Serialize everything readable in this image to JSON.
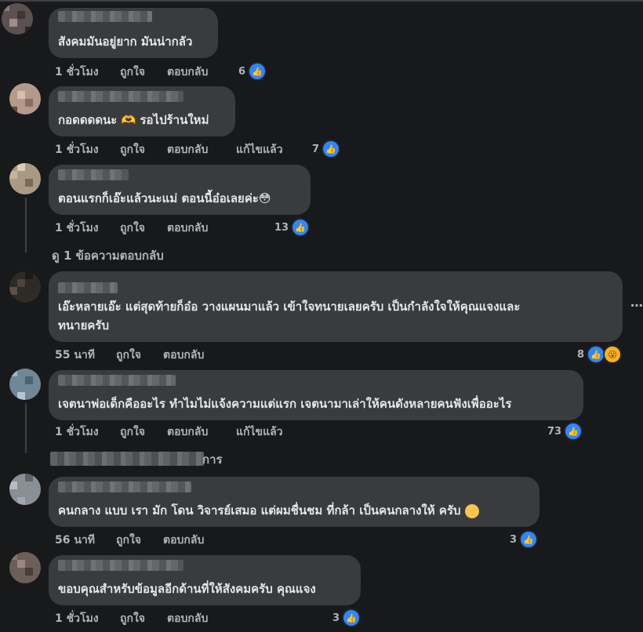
{
  "comments": [
    {
      "text": "สังคมมันอยู่ยาก มันน่ากลัว",
      "time": "1 ชั่วโมง",
      "like": "ถูกใจ",
      "reply": "ตอบกลับ",
      "edited": "",
      "count": "6"
    },
    {
      "text": "กอดดดดนะ 🫶 รอไปร้านใหม่",
      "time": "1 ชั่วโมง",
      "like": "ถูกใจ",
      "reply": "ตอบกลับ",
      "edited": "แก้ไขแล้ว",
      "count": "7"
    },
    {
      "text": "ตอนแรกก็เอ๊ะแล้วนะแม่ ตอนนี้อ๋อเลยค่ะ😳",
      "time": "1 ชั่วโมง",
      "like": "ถูกใจ",
      "reply": "ตอบกลับ",
      "edited": "",
      "count": "13"
    },
    {
      "text_line1": "เอ๊ะหลายเอ๊ะ แต่สุดท้ายก็อ๋อ วางแผนมาแล้ว เข้าใจทนายเลยครับ เป็นกำลังใจให้คุณแจงและ",
      "text_line2": "ทนายครับ",
      "time": "55 นาที",
      "like": "ถูกใจ",
      "reply": "ตอบกลับ",
      "edited": "",
      "count": "8"
    },
    {
      "text": "เจตนาพ่อเด็กคืออะไร ทำไมไม่แจ้งความแต่แรก เจตนามาเล่าให้คนดังหลายคนฟังเพื่ออะไร",
      "time": "1 ชั่วโมง",
      "like": "ถูกใจ",
      "reply": "ตอบกลับ",
      "edited": "แก้ไขแล้ว",
      "count": "73"
    },
    {
      "text": "คนกลาง แบบ เรา มัก โดน วิจารย์เสมอ แต่ผมชื่นชม ที่กล้า เป็นคนกลางให้ ครับ",
      "time": "56 นาที",
      "like": "ถูกใจ",
      "reply": "ตอบกลับ",
      "edited": "",
      "count": "3"
    },
    {
      "text": "ขอบคุณสำหรับข้อมูลอีกด้านที่ให้สังคมครับ คุณแจง",
      "time": "1 ชั่วโมง",
      "like": "ถูกใจ",
      "reply": "ตอบกลับ",
      "edited": "",
      "count": "3"
    }
  ],
  "view_replies": "ดู 1 ข้อความตอบกลับ",
  "partial_reply_suffix": "การ",
  "colors": {
    "background": "#18191a",
    "bubble": "#3a3b3c",
    "like_blue": "#2d88ff",
    "meta_text": "#b0b3b8"
  },
  "icons": {
    "like": "thumbs-up-icon",
    "wow": "wow-face-icon",
    "more": "more-dots-icon"
  }
}
